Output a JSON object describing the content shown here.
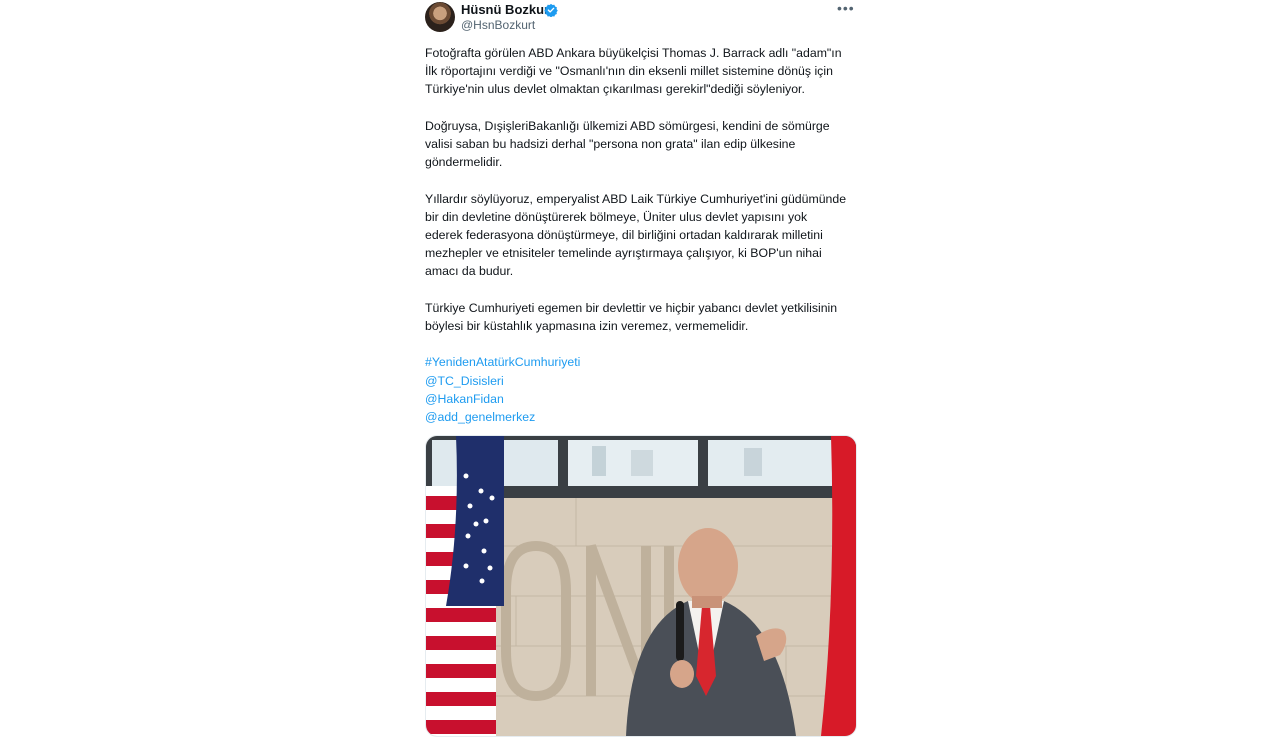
{
  "author": {
    "display_name": "Hüsnü Bozkurt",
    "handle": "@HsnBozkurt",
    "verified": true
  },
  "tweet": {
    "paragraphs": [
      "Fotoğrafta görülen ABD Ankara büyükelçisi Thomas J. Barrack adlı \"adam\"ın\nİlk röportajını verdiği ve \"Osmanlı'nın din eksenli millet sistemine dönüş için\nTürkiye'nin ulus devlet olmaktan çıkarılması gerekirl\"dediği söyleniyor.",
      "Doğruysa, DışişleriBakanlığı ülkemizi ABD sömürgesi, kendini de sömürge\nvalisi saban bu hadsizi derhal \"persona non grata\" ilan edip ülkesine\ngöndermelidir.",
      "Yıllardır söylüyoruz, emperyalist ABD Laik Türkiye Cumhuriyet'ini güdümünde\nbir din devletine dönüştürerek bölmeye, Üniter ulus devlet yapısını yok\nederek federasyona dönüştürmeye, dil birliğini ortadan kaldırarak milletini\nmezhepler ve etnisiteler temelinde ayrıştırmaya çalışıyor, ki BOP'un nihai\namacı da budur.",
      "Türkiye Cumhuriyeti egemen bir devlettir ve hiçbir yabancı devlet yetkilisinin\nböylesi bir küstahlık yapmasına izin veremez, vermemelidir."
    ],
    "hashtag": "#YenidenAtatürkCumhuriyeti",
    "mentions": [
      "@TC_Disisleri",
      "@HakanFidan",
      "@add_genelmerkez"
    ]
  },
  "colors": {
    "link": "#1d9bf0",
    "verified": "#1d9bf0",
    "text": "#0f1419",
    "secondary": "#536471"
  },
  "icons": {
    "verified": "verified-badge-icon",
    "more": "more-options-icon"
  }
}
